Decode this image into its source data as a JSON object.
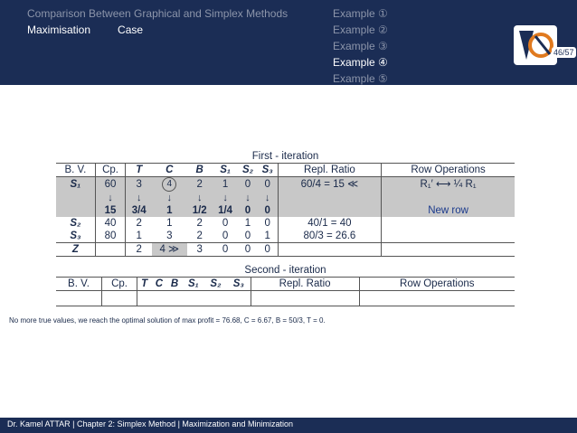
{
  "nav": {
    "section": "Comparison Between Graphical and Simplex Methods",
    "subsection_a": "Maximisation",
    "subsection_b": "Case",
    "examples": [
      "Example ①",
      "Example ②",
      "Example ③",
      "Example ④",
      "Example ⑤"
    ],
    "current_example_index": 3
  },
  "page_number": "46/57",
  "first": {
    "title": "First - iteration",
    "headers": [
      "B. V.",
      "Cp.",
      "T",
      "C",
      "B",
      "S₁",
      "S₂",
      "S₃",
      "Repl. Ratio",
      "Row Operations"
    ],
    "r1": [
      "S₁",
      "60",
      "3",
      "4",
      "2",
      "1",
      "0",
      "0",
      "60/4 = 15 ≪",
      "R₁′ ⟷ ¼ R₁"
    ],
    "r1b": [
      "15",
      "3/4",
      "1",
      "1/2",
      "1/4",
      "0",
      "0",
      "New row"
    ],
    "r2": [
      "S₂",
      "40",
      "2",
      "1",
      "2",
      "0",
      "1",
      "0",
      "40/1 = 40",
      ""
    ],
    "r3": [
      "S₃",
      "80",
      "1",
      "3",
      "2",
      "0",
      "0",
      "1",
      "80/3 = 26.6",
      ""
    ],
    "rz": [
      "Z",
      "",
      "2",
      "4 ≫",
      "3",
      "0",
      "0",
      "0",
      "",
      ""
    ]
  },
  "second": {
    "title": "Second - iteration",
    "headers": [
      "B. V.",
      "Cp.",
      "T",
      "C",
      "B",
      "S₁",
      "S₂",
      "S₃",
      "Repl. Ratio",
      "Row Operations"
    ]
  },
  "conclusion": "No more true values, we reach the optimal solution of max profit = 76.68, C = 6.67, B = 50/3, T = 0.",
  "footer": "Dr. Kamel ATTAR | Chapter 2: Simplex Method | Maximization and Minimization"
}
